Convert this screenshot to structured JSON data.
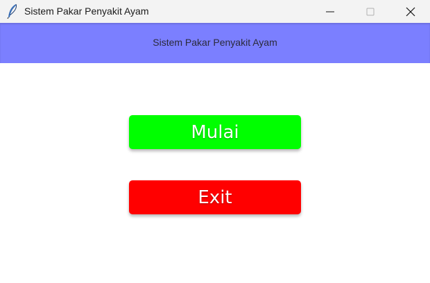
{
  "window": {
    "title": "Sistem Pakar Penyakit Ayam",
    "icon": "feather-icon"
  },
  "header": {
    "title": "Sistem Pakar Penyakit Ayam",
    "background": "#7b7fff"
  },
  "buttons": {
    "start_label": "Mulai",
    "start_color": "#00ff00",
    "exit_label": "Exit",
    "exit_color": "#ff0000"
  }
}
